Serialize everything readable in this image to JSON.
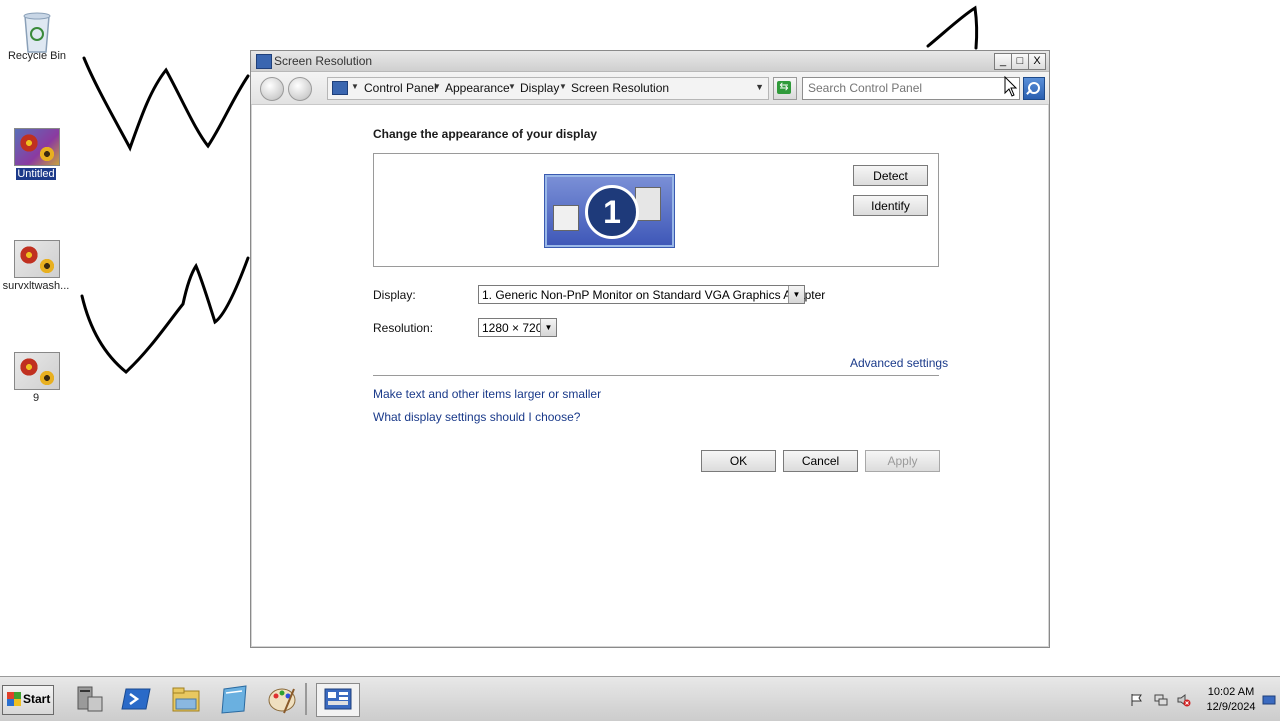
{
  "desktop": {
    "icons": [
      {
        "label": "Recycle Bin",
        "icon": "recycle-bin-icon",
        "selected": false
      },
      {
        "label": "Untitled",
        "icon": "image-file-icon",
        "selected": true
      },
      {
        "label": "survxltwash...",
        "icon": "image-file-icon",
        "selected": false
      },
      {
        "label": "9",
        "icon": "image-file-icon",
        "selected": false
      }
    ]
  },
  "window": {
    "title": "Screen Resolution",
    "controls": {
      "minimize": "_",
      "maximize": "□",
      "close": "X"
    },
    "breadcrumbs": [
      "Control Panel",
      "Appearance",
      "Display",
      "Screen Resolution"
    ],
    "search_placeholder": "Search Control Panel"
  },
  "content": {
    "heading": "Change the appearance of your display",
    "monitor_number": "1",
    "detect_label": "Detect",
    "identify_label": "Identify",
    "display_label": "Display:",
    "display_value": "1. Generic Non-PnP Monitor on Standard VGA Graphics Adapter",
    "resolution_label": "Resolution:",
    "resolution_value": "1280 × 720",
    "advanced_settings": "Advanced settings",
    "link_text_size": "Make text and other items larger or smaller",
    "link_help": "What display settings should I choose?",
    "ok_label": "OK",
    "cancel_label": "Cancel",
    "apply_label": "Apply"
  },
  "taskbar": {
    "start_label": "Start",
    "pinned": [
      "server-manager-icon",
      "powershell-icon",
      "file-explorer-icon",
      "notepad-icon",
      "paint-icon",
      "control-panel-icon"
    ],
    "tray": [
      "action-center-flag-icon",
      "network-icon",
      "volume-muted-icon"
    ],
    "time": "10:02 AM",
    "date": "12/9/2024"
  },
  "colors": {
    "link": "#1a3a8a",
    "selection": "#1c3a8a",
    "monitor_blue": "#3f58b8"
  }
}
